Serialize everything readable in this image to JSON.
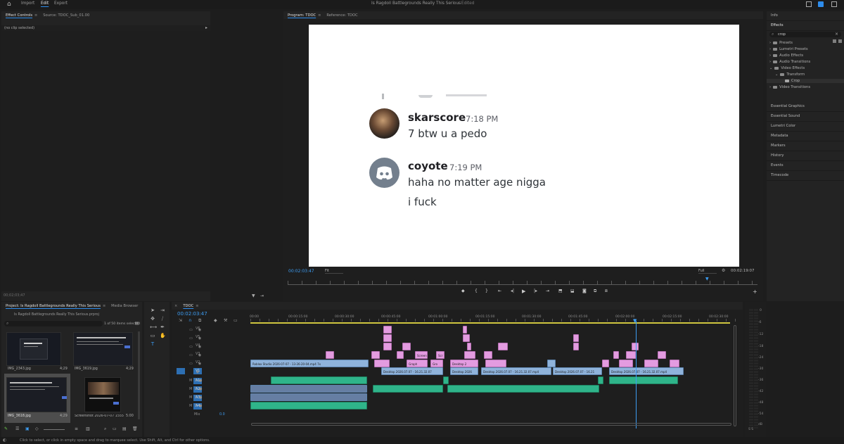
{
  "topbar": {
    "home_icon": "home-icon",
    "nav": [
      "Import",
      "Edit",
      "Export"
    ],
    "active_nav": "Edit",
    "project_title": "Is Ragdoll Battlegrounds Really This Serious",
    "edited": "- Edited"
  },
  "effect_controls": {
    "tab_active": "Effect Controls",
    "tab_source": "Source: TDOC_Sub_01.00",
    "no_clip": "(no clip selected)",
    "timecode": "00;02;03;47"
  },
  "program": {
    "tab_active": "Program: TDOC",
    "tab_reference": "Reference: TDOC",
    "timecode": "00:02:03:47",
    "fit": "Fit",
    "quality": "Full",
    "duration": "00:02:19:07"
  },
  "discord": {
    "messages": [
      {
        "name": "skarscore",
        "time": "7:18 PM",
        "lines": [
          "7 btw u a pedo"
        ]
      },
      {
        "name": "coyote",
        "time": "7:19 PM",
        "lines": [
          "haha no matter age nigga",
          "i fuck"
        ]
      }
    ]
  },
  "right_panel": {
    "info": "Info",
    "effects": "Effects",
    "search": "crop",
    "tree": [
      {
        "label": "Presets",
        "indent": 0
      },
      {
        "label": "Lumetri Presets",
        "indent": 0
      },
      {
        "label": "Audio Effects",
        "indent": 0
      },
      {
        "label": "Audio Transitions",
        "indent": 0
      },
      {
        "label": "Video Effects",
        "indent": 0
      },
      {
        "label": "Transform",
        "indent": 1
      },
      {
        "label": "Crop",
        "indent": 2
      },
      {
        "label": "Video Transitions",
        "indent": 0
      }
    ],
    "panels": [
      "Essential Graphics",
      "Essential Sound",
      "Lumetri Color",
      "Metadata",
      "Markers",
      "History",
      "Events",
      "Timecode"
    ]
  },
  "project": {
    "tab_active": "Project: Is Ragdoll Battlegrounds Really This Serious",
    "tab_media": "Media Browser",
    "path": "Is Ragdoll Battlegrounds Really This Serious.prproj",
    "selected": "1 of 50 items selected",
    "items": [
      {
        "name": "IMG_2343.jpg",
        "dur": "4;29"
      },
      {
        "name": "IMG_3619.jpg",
        "dur": "4;29"
      },
      {
        "name": "IMG_3618.jpg",
        "dur": "4;29"
      },
      {
        "name": "Screenshot 2026-07-07 1555...",
        "dur": "5:00"
      }
    ]
  },
  "timeline": {
    "tab": "TDOC",
    "timecode": "00:02:03:47",
    "ruler": [
      "00:00",
      "00:00:15:00",
      "00:00:30:00",
      "00:00:45:00",
      "00:01:00:00",
      "00:01:15:00",
      "00:01:30:00",
      "00:01:45:00",
      "00:02:00:00",
      "00:02:15:00",
      "00:02:30:00"
    ],
    "video_tracks": [
      "V6",
      "V5",
      "V4",
      "V3",
      "V2",
      "V1"
    ],
    "audio_tracks": [
      "A1",
      "A2",
      "A3",
      "A4"
    ],
    "mix": "Mix",
    "mix_value": "0.0",
    "clip_labels": {
      "roblox": "Roblox Studio 2026-07-07 - 13-26-20-04.mp4 7x",
      "d1": "Desktop 2026.07.07 - 16.21.32.07",
      "d2": "Desktop 2026",
      "d3": "Desktop 2026.07.07 - 16.21",
      "d4": "Desktop 2026.07.07 - 16.21.32.07.mp4",
      "screen": "Screen",
      "sc": "Scr",
      "graph": "Graph",
      "gro": "Gro",
      "desk": "Desktop 2"
    },
    "vu_scale": [
      "0",
      "-6",
      "-12",
      "-18",
      "-24",
      "-30",
      "-36",
      "-42",
      "-48",
      "-54",
      "dB"
    ],
    "vu_bottom": "S S"
  },
  "status": "Click to select, or click in empty space and drag to marquee select. Use Shift, Alt, and Ctrl for other options."
}
